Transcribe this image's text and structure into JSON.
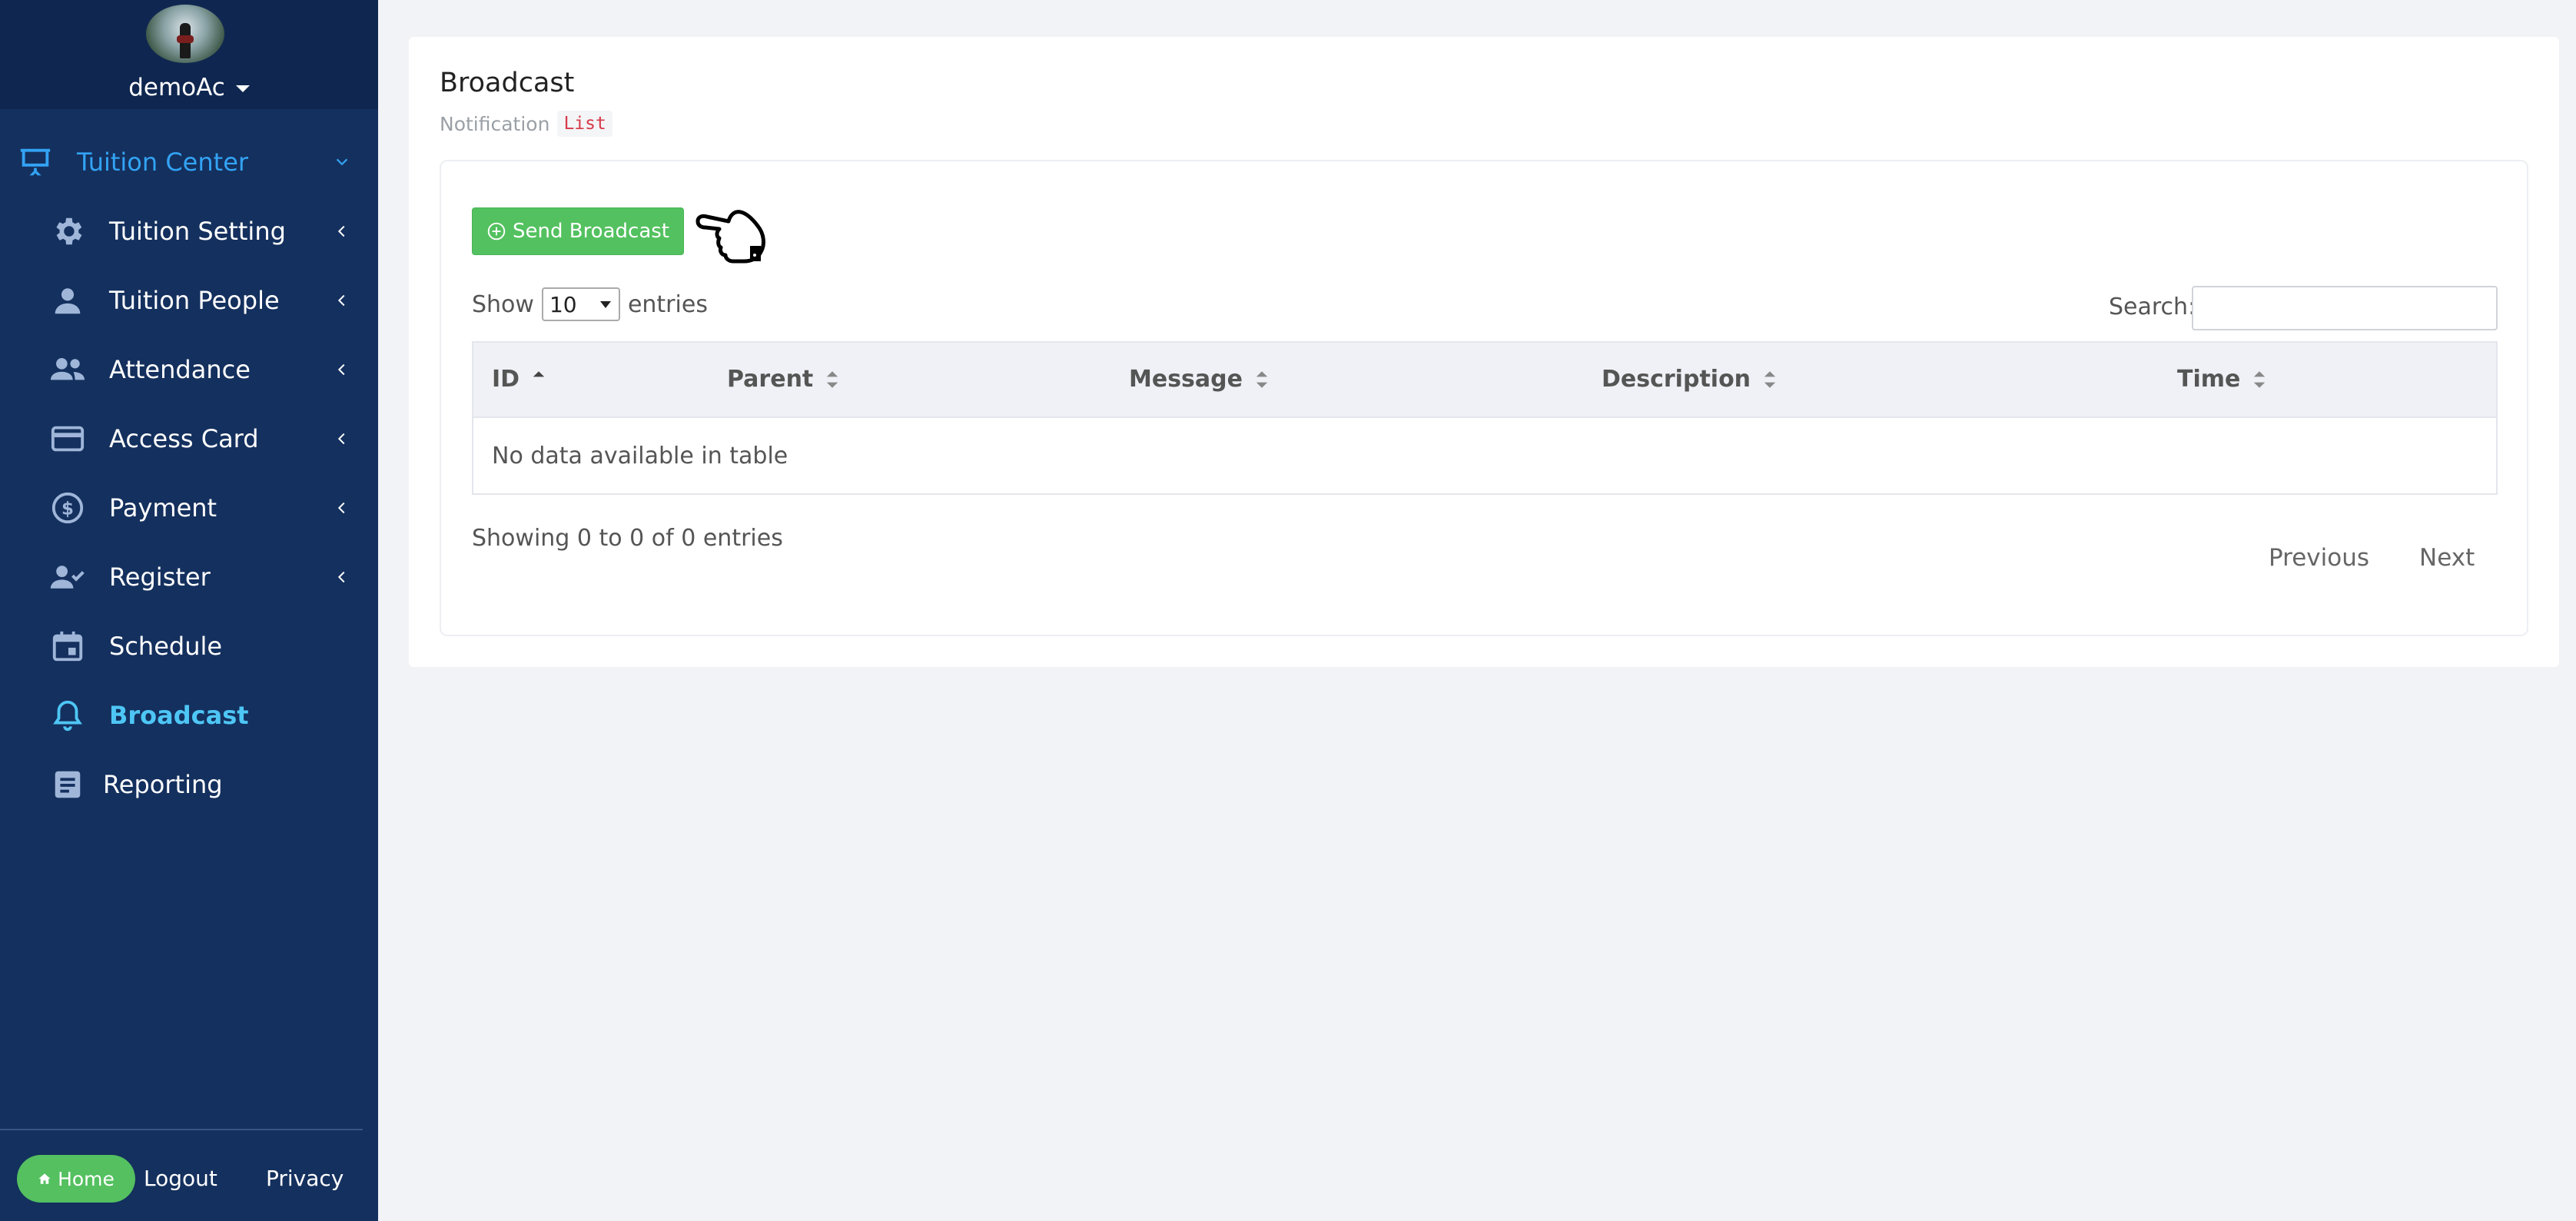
{
  "user": {
    "name": "demoAc"
  },
  "sidebar": {
    "items": [
      {
        "label": "Tuition Center"
      },
      {
        "label": "Tuition Setting"
      },
      {
        "label": "Tuition People"
      },
      {
        "label": "Attendance"
      },
      {
        "label": "Access Card"
      },
      {
        "label": "Payment"
      },
      {
        "label": "Register"
      },
      {
        "label": "Schedule"
      },
      {
        "label": "Broadcast"
      },
      {
        "label": "Reporting"
      }
    ],
    "footer": {
      "home_label": "Home",
      "logout_label": "Logout",
      "privacy_label": "Privacy"
    }
  },
  "page": {
    "title": "Broadcast",
    "subtitle": "Notification",
    "badge": "List"
  },
  "toolbar": {
    "send_label": "Send Broadcast"
  },
  "table": {
    "show_label": "Show",
    "length_value": "10",
    "entries_label": "entries",
    "search_label": "Search:",
    "search_value": "",
    "columns": [
      "ID",
      "Parent",
      "Message",
      "Description",
      "Time"
    ],
    "empty_message": "No data available in table",
    "info": "Showing 0 to 0 of 0 entries",
    "prev_label": "Previous",
    "next_label": "Next"
  },
  "colors": {
    "sidebar_bg": "#14305e",
    "accent_blue": "#33a3f4",
    "active_cyan": "#4ec6f5",
    "success_green": "#53c15f"
  }
}
